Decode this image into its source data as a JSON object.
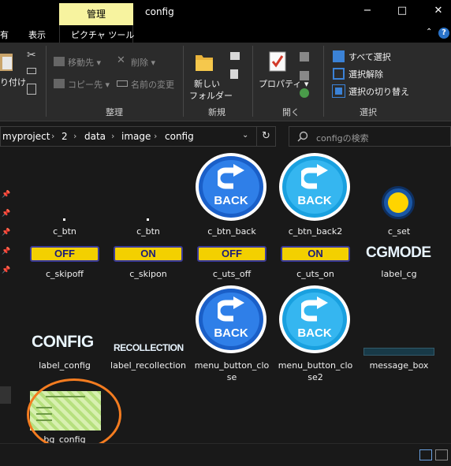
{
  "window": {
    "context_tab": "管理",
    "title": "config",
    "minimize": "−",
    "maximize": "□",
    "close": "✕"
  },
  "tabs": {
    "share": "有",
    "view": "表示",
    "picture_tools": "ピクチャ ツール",
    "help": "?"
  },
  "ribbon": {
    "clipboard": {
      "paste": "り付け"
    },
    "organize": {
      "move_to": "移動先",
      "copy_to": "コピー先",
      "delete": "削除",
      "rename": "名前の変更",
      "label": "整理"
    },
    "new": {
      "new_folder_line1": "新しい",
      "new_folder_line2": "フォルダー",
      "label": "新規"
    },
    "open": {
      "properties": "プロパティ",
      "label": "開く"
    },
    "select": {
      "select_all": "すべて選択",
      "select_none": "選択解除",
      "invert": "選択の切り替え",
      "label": "選択"
    }
  },
  "address": {
    "crumbs": [
      "myproject",
      "2",
      "data",
      "image",
      "config"
    ],
    "search_placeholder": "configの検索"
  },
  "files": [
    {
      "name": "c_btn",
      "thumb": "dot"
    },
    {
      "name": "c_btn",
      "thumb": "dot"
    },
    {
      "name": "c_btn_back",
      "thumb": "back-dark",
      "text": "BACK"
    },
    {
      "name": "c_btn_back2",
      "thumb": "back-light",
      "text": "BACK"
    },
    {
      "name": "c_set",
      "thumb": "set"
    },
    {
      "name": "c_skipoff",
      "thumb": "pill",
      "text": "OFF"
    },
    {
      "name": "c_skipon",
      "thumb": "pill",
      "text": "ON"
    },
    {
      "name": "c_uts_off",
      "thumb": "pill",
      "text": "OFF"
    },
    {
      "name": "c_uts_on",
      "thumb": "pill",
      "text": "ON"
    },
    {
      "name": "label_cg",
      "thumb": "text",
      "text": "CGMODE"
    },
    {
      "name": "label_config",
      "thumb": "text",
      "text": "CONFIG"
    },
    {
      "name": "label_recollection",
      "thumb": "text",
      "text": "RECOLLECTION"
    },
    {
      "name": "menu_button_close",
      "name_line1": "menu_button_clo",
      "name_line2": "se",
      "thumb": "back-dark",
      "text": "BACK"
    },
    {
      "name": "menu_button_close2",
      "name_line1": "menu_button_clo",
      "name_line2": "se2",
      "thumb": "back-light",
      "text": "BACK"
    },
    {
      "name": "message_box",
      "thumb": "bar"
    },
    {
      "name": "bg_config",
      "thumb": "bg",
      "highlighted": true
    }
  ],
  "colors": {
    "accent": "#f47c20",
    "back_dark": "#1a5fc8",
    "back_light": "#2fa9e6",
    "pill": "#f3d000"
  }
}
